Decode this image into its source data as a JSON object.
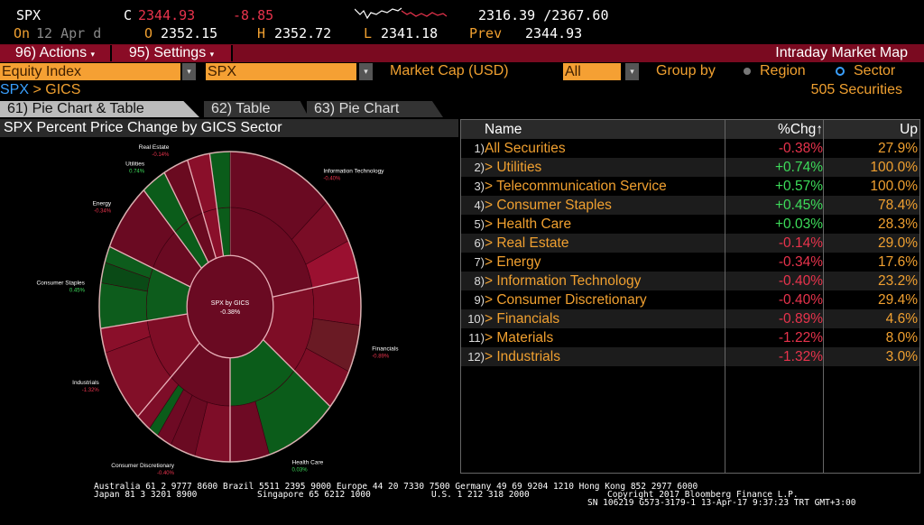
{
  "quote": {
    "ticker": "SPX",
    "c_label": "C",
    "last": "2344.93",
    "change": "-8.85",
    "range": "2316.39 /2367.60",
    "on_label": "On",
    "date": "12 Apr d",
    "o_label": "O",
    "open": "2352.15",
    "h_label": "H",
    "high": "2352.72",
    "l_label": "L",
    "low": "2341.18",
    "prev_label": "Prev",
    "prev": "2344.93"
  },
  "toolbar": {
    "actions": "96) Actions",
    "settings": "95) Settings",
    "title": "Intraday Market Map",
    "dropdown_arrow": "▾"
  },
  "filters": {
    "asset_type": "Equity Index",
    "index": "SPX",
    "market_cap_label": "Market Cap (USD)",
    "market_cap": "All",
    "group_by_label": "Group by",
    "region": "Region",
    "sector": "Sector",
    "selected_group": "Sector"
  },
  "breadcrumb": {
    "root": "SPX",
    "sep": " > ",
    "current": "GICS"
  },
  "securities_count": "505 Securities",
  "tabs": [
    {
      "label": "61) Pie Chart & Table",
      "active": true
    },
    {
      "label": "62) Table"
    },
    {
      "label": "63) Pie Chart"
    }
  ],
  "panel_title": "SPX Percent Price Change by GICS Sector",
  "table": {
    "headers": {
      "name": "Name",
      "chg": "%Chg↑",
      "up": "Up"
    },
    "rows": [
      {
        "num": "1)",
        "name": "All Securities",
        "chg": "-0.38%",
        "up": "27.9%"
      },
      {
        "num": "2)",
        "name": "> Utilities",
        "chg": "+0.74%",
        "up": "100.0%"
      },
      {
        "num": "3)",
        "name": "> Telecommunication Service",
        "chg": "+0.57%",
        "up": "100.0%"
      },
      {
        "num": "4)",
        "name": "> Consumer Staples",
        "chg": "+0.45%",
        "up": "78.4%"
      },
      {
        "num": "5)",
        "name": "> Health Care",
        "chg": "+0.03%",
        "up": "28.3%"
      },
      {
        "num": "6)",
        "name": "> Real Estate",
        "chg": "-0.14%",
        "up": "29.0%"
      },
      {
        "num": "7)",
        "name": "> Energy",
        "chg": "-0.34%",
        "up": "17.6%"
      },
      {
        "num": "8)",
        "name": "> Information Technology",
        "chg": "-0.40%",
        "up": "23.2%"
      },
      {
        "num": "9)",
        "name": "> Consumer Discretionary",
        "chg": "-0.40%",
        "up": "29.4%"
      },
      {
        "num": "10)",
        "name": "> Financials",
        "chg": "-0.89%",
        "up": "4.6%"
      },
      {
        "num": "11)",
        "name": "> Materials",
        "chg": "-1.22%",
        "up": "8.0%"
      },
      {
        "num": "12)",
        "name": "> Industrials",
        "chg": "-1.32%",
        "up": "3.0%"
      }
    ]
  },
  "chart_data": {
    "type": "pie",
    "variant": "sunburst",
    "center_label": "SPX by GICS",
    "center_value": "-0.38%",
    "slices": [
      {
        "name": "Information Technology",
        "value": "-0.40%",
        "share": 22.0,
        "color": "#6a0a22",
        "outer": [
          [
            "#6a0a22",
            0.6
          ],
          [
            "#7a0d26",
            0.22
          ],
          [
            "#9a1030",
            0.18
          ]
        ],
        "label": true
      },
      {
        "name": "Financials",
        "value": "-0.89%",
        "share": 14.2,
        "color": "#7e0d26",
        "outer": [
          [
            "#7e0d26",
            0.35
          ],
          [
            "#6a1a24",
            0.35
          ],
          [
            "#7e0d26",
            0.3
          ]
        ],
        "label": true
      },
      {
        "name": "Health Care",
        "value": "0.03%",
        "share": 13.9,
        "color": "#0b5c1a",
        "outer": [
          [
            "#0b5c1a",
            0.65
          ],
          [
            "#6e0a24",
            0.35
          ]
        ],
        "label": true
      },
      {
        "name": "Consumer Discretionary",
        "value": "-0.40%",
        "share": 12.5,
        "color": "#6a0a22",
        "outer": [
          [
            "#7e0d28",
            0.35
          ],
          [
            "#6a0a22",
            0.25
          ],
          [
            "#6e0a24",
            0.15
          ],
          [
            "#0b5c1a",
            0.1
          ],
          [
            "#7e0d28",
            0.15
          ]
        ],
        "label": true
      },
      {
        "name": "Industrials",
        "value": "-1.32%",
        "share": 10.3,
        "color": "#7e0d26",
        "outer": [
          [
            "#820f28",
            0.75
          ],
          [
            "#8a0f2a",
            0.25
          ]
        ],
        "label": true
      },
      {
        "name": "Consumer Staples",
        "value": "0.45%",
        "share": 8.6,
        "color": "#0d5c1c",
        "outer": [
          [
            "#0d5c1c",
            0.55
          ],
          [
            "#0a4a16",
            0.25
          ],
          [
            "#0d5c1c",
            0.2
          ]
        ],
        "label": true
      },
      {
        "name": "Energy",
        "value": "-0.34%",
        "share": 7.2,
        "color": "#6a0a22",
        "outer": [
          [
            "#6a0a22",
            1
          ]
        ],
        "label": true
      },
      {
        "name": "Utilities",
        "value": "0.74%",
        "share": 3.1,
        "color": "#0b5c1a",
        "outer": [
          [
            "#0b5c1a",
            1
          ]
        ],
        "label": true
      },
      {
        "name": "Real Estate",
        "value": "-0.14%",
        "share": 3.1,
        "color": "#6a0a20",
        "outer": [
          [
            "#6a0a20",
            1
          ]
        ],
        "label": true
      },
      {
        "name": "Materials",
        "value": "-1.22%",
        "share": 2.8,
        "color": "#8a0f2a",
        "outer": [
          [
            "#8a0f2a",
            1
          ]
        ],
        "label": false
      },
      {
        "name": "Telecommunication Service",
        "value": "0.57%",
        "share": 2.5,
        "color": "#0b5c1a",
        "outer": [
          [
            "#0b5c1a",
            1
          ]
        ],
        "label": false
      }
    ]
  },
  "footer": {
    "line1": "Australia 61 2 9777 8600 Brazil 5511 2395 9000 Europe 44 20 7330 7500 Germany 49 69 9204 1210 Hong Kong 852 2977 6000",
    "line2a": "Japan 81 3 3201 8900",
    "line2b": "Singapore 65 6212 1000",
    "line2c": "U.S. 1 212 318 2000",
    "line2d": "Copyright 2017 Bloomberg Finance L.P.",
    "line3": "SN 106219 G573-3179-1 13-Apr-17  9:37:23 TRT  GMT+3:00"
  },
  "colors": {
    "accent_orange": "#f5a033",
    "bar_red": "#7a0a20",
    "up": "#3ddc5a",
    "down": "#e8334c"
  }
}
